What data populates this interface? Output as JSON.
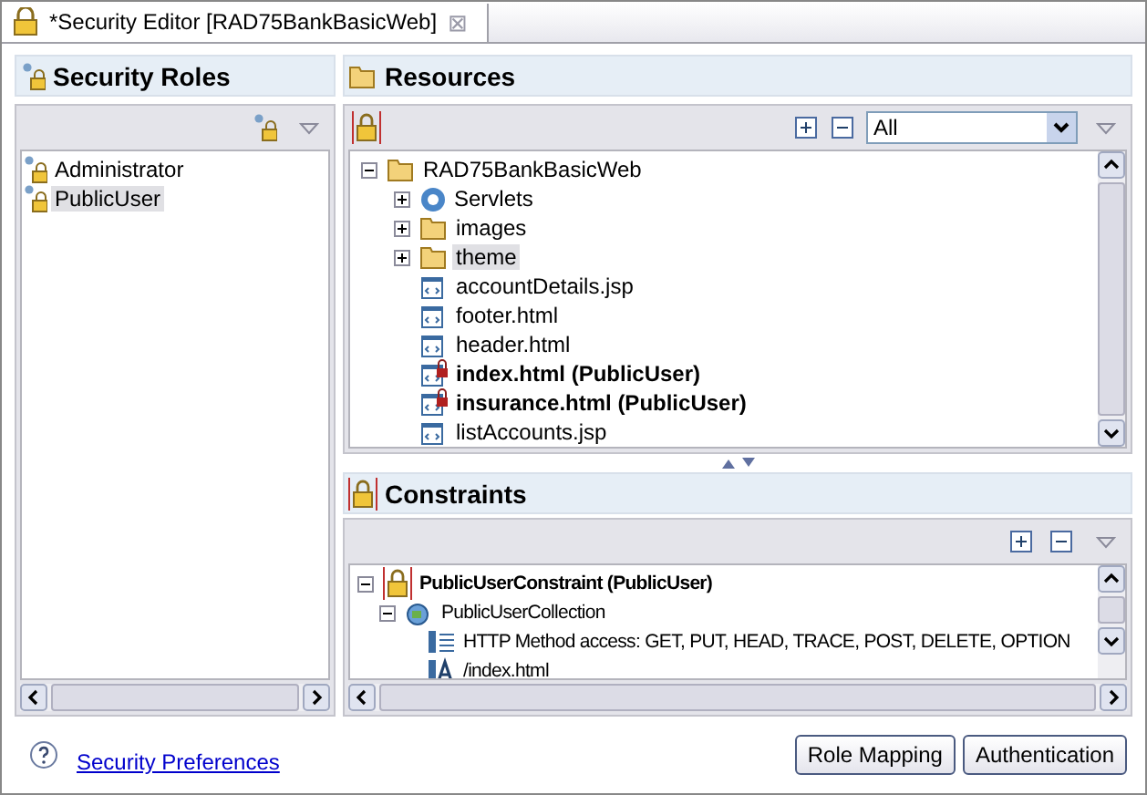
{
  "editor_tab": {
    "title": "*Security Editor [RAD75BankBasicWeb]",
    "close": "⊠"
  },
  "security_roles": {
    "title": "Security Roles",
    "roles": [
      {
        "name": "Administrator",
        "selected": false
      },
      {
        "name": "PublicUser",
        "selected": true
      }
    ]
  },
  "resources": {
    "title": "Resources",
    "filter": {
      "value": "All"
    },
    "tree": [
      {
        "label": "RAD75BankBasicWeb",
        "kind": "folder",
        "expanded": true,
        "selected": false,
        "secured": false,
        "children": [
          {
            "label": "Servlets",
            "kind": "servlet",
            "expanded": false,
            "selected": false,
            "secured": false
          },
          {
            "label": "images",
            "kind": "folder",
            "expanded": false,
            "selected": false,
            "secured": false
          },
          {
            "label": "theme",
            "kind": "folder",
            "expanded": false,
            "selected": true,
            "secured": false
          },
          {
            "label": "accountDetails.jsp",
            "kind": "file",
            "selected": false,
            "secured": false
          },
          {
            "label": "footer.html",
            "kind": "file",
            "selected": false,
            "secured": false
          },
          {
            "label": "header.html",
            "kind": "file",
            "selected": false,
            "secured": false
          },
          {
            "label": "index.html  (PublicUser)",
            "kind": "file",
            "selected": false,
            "secured": true
          },
          {
            "label": "insurance.html  (PublicUser)",
            "kind": "file",
            "selected": false,
            "secured": true
          },
          {
            "label": "listAccounts.jsp",
            "kind": "file",
            "selected": false,
            "secured": false
          }
        ]
      }
    ]
  },
  "constraints": {
    "title": "Constraints",
    "tree": [
      {
        "label": "PublicUserConstraint (PublicUser)",
        "kind": "constraint",
        "expanded": true,
        "selected": false,
        "secured": true,
        "children": [
          {
            "label": "PublicUserCollection",
            "kind": "collection",
            "expanded": true,
            "selected": false,
            "secured": false,
            "children": [
              {
                "label": "HTTP Method access: GET, PUT, HEAD, TRACE, POST, DELETE, OPTION",
                "kind": "methods",
                "selected": false,
                "secured": false
              },
              {
                "label": "/index.html",
                "kind": "pattern",
                "selected": false,
                "secured": false
              }
            ]
          }
        ]
      }
    ]
  },
  "footer": {
    "link": "Security Preferences",
    "buttons": [
      "Role Mapping",
      "Authentication"
    ]
  }
}
